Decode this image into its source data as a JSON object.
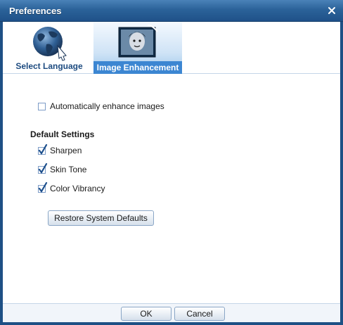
{
  "window": {
    "title": "Preferences"
  },
  "tabs": [
    {
      "label": "Select Language",
      "icon": "globe-icon",
      "selected": false
    },
    {
      "label": "Image Enhancement",
      "icon": "photo-icon",
      "selected": true
    }
  ],
  "options": {
    "auto_enhance": {
      "label": "Automatically enhance images",
      "checked": false
    }
  },
  "default_settings": {
    "heading": "Default Settings",
    "items": [
      {
        "label": "Sharpen",
        "checked": true
      },
      {
        "label": "Skin Tone",
        "checked": true
      },
      {
        "label": "Color Vibrancy",
        "checked": true
      }
    ]
  },
  "restore_label": "Restore System Defaults",
  "footer": {
    "ok_label": "OK",
    "cancel_label": "Cancel"
  },
  "colors": {
    "titlebar": "#2b6299",
    "selected_tab": "#3c86d2",
    "check": "#1d4f8c",
    "label_text": "#1d4b80"
  }
}
